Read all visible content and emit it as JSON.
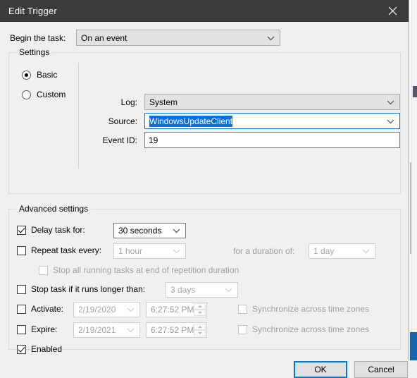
{
  "window": {
    "title": "Edit Trigger",
    "close_icon": "close-icon"
  },
  "begin": {
    "label": "Begin the task:",
    "value": "On an event",
    "chevron_icon": "chevron-down-icon"
  },
  "settings": {
    "legend": "Settings",
    "mode": {
      "basic_label": "Basic",
      "custom_label": "Custom",
      "selected": "Basic"
    },
    "fields": {
      "log_label": "Log:",
      "log_value": "System",
      "source_label": "Source:",
      "source_value": "WindowsUpdateClient",
      "event_id_label": "Event ID:",
      "event_id_value": "19"
    }
  },
  "advanced": {
    "legend": "Advanced settings",
    "delay": {
      "label": "Delay task for:",
      "checked": true,
      "value": "30 seconds"
    },
    "repeat": {
      "label": "Repeat task every:",
      "checked": false,
      "value": "1 hour",
      "duration_label": "for a duration of:",
      "duration_value": "1 day"
    },
    "stop_all": {
      "label": "Stop all running tasks at end of repetition duration",
      "checked": false
    },
    "stop_longer": {
      "label": "Stop task if it runs longer than:",
      "checked": false,
      "value": "3 days"
    },
    "activate": {
      "label": "Activate:",
      "checked": false,
      "date": "2/19/2020",
      "time": "6:27:52 PM",
      "sync_label": "Synchronize across time zones",
      "sync_checked": false
    },
    "expire": {
      "label": "Expire:",
      "checked": false,
      "date": "2/19/2021",
      "time": "6:27:52 PM",
      "sync_label": "Synchronize across time zones",
      "sync_checked": false
    },
    "enabled": {
      "label": "Enabled",
      "checked": true
    }
  },
  "footer": {
    "ok_label": "OK",
    "cancel_label": "Cancel"
  },
  "colors": {
    "titlebar": "#3b3b3b",
    "dialog_bg": "#f0f0f0",
    "accent": "#0078d7",
    "selection": "#0b6fd4",
    "disabled_text": "#a0a0a0"
  }
}
